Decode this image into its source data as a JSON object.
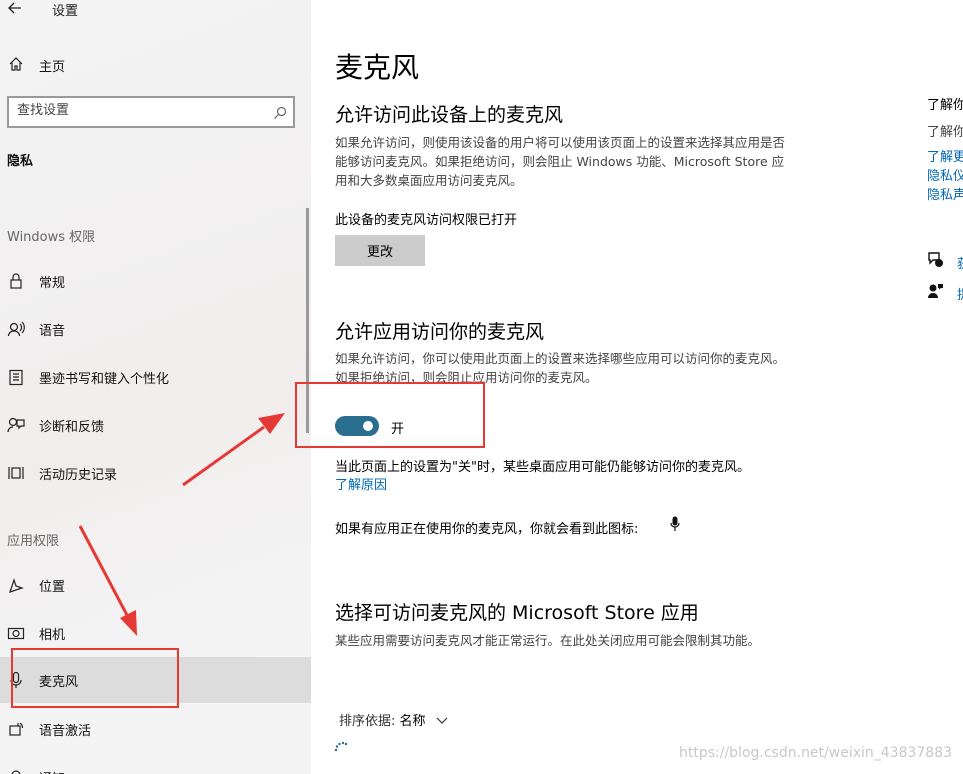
{
  "window": {
    "title": "设置"
  },
  "sidebar": {
    "home_label": "主页",
    "search": {
      "placeholder": "查找设置"
    },
    "section_title": "隐私",
    "windows_permissions": {
      "heading": "Windows 权限",
      "items": [
        {
          "label": "常规",
          "icon": "lock-icon"
        },
        {
          "label": "语音",
          "icon": "speech-icon"
        },
        {
          "label": "墨迹书写和键入个性化",
          "icon": "clipboard-icon"
        },
        {
          "label": "诊断和反馈",
          "icon": "feedback-icon"
        },
        {
          "label": "活动历史记录",
          "icon": "timeline-icon"
        }
      ]
    },
    "app_permissions": {
      "heading": "应用权限",
      "items": [
        {
          "label": "位置",
          "icon": "location-icon"
        },
        {
          "label": "相机",
          "icon": "camera-icon"
        },
        {
          "label": "麦克风",
          "icon": "microphone-icon",
          "selected": true
        },
        {
          "label": "语音激活",
          "icon": "voice-activation-icon"
        },
        {
          "label": "通知",
          "icon": "notification-icon"
        }
      ]
    }
  },
  "main": {
    "title": "麦克风",
    "device_section": {
      "heading": "允许访问此设备上的麦克风",
      "description": "如果允许访问，则使用该设备的用户将可以使用该页面上的设置来选择其应用是否能够访问麦克风。如果拒绝访问，则会阻止 Windows 功能、Microsoft Store 应用和大多数桌面应用访问麦克风。",
      "status": "此设备的麦克风访问权限已打开",
      "change_button": "更改"
    },
    "apps_section": {
      "heading": "允许应用访问你的麦克风",
      "description": "如果允许访问，你可以使用此页面上的设置来选择哪些应用可以访问你的麦克风。如果拒绝访问，则会阻止应用访问你的麦克风。",
      "toggle_state": "开",
      "toggle_on": true,
      "note": "当此页面上的设置为\"关\"时，某些桌面应用可能仍能够访问你的麦克风。",
      "learn_why_link": "了解原因",
      "icon_note": "如果有应用正在使用你的麦克风，你就会看到此图标:"
    },
    "store_section": {
      "heading": "选择可访问麦克风的 Microsoft Store 应用",
      "description": "某些应用需要访问麦克风才能正常运行。在此处关闭应用可能会限制其功能。",
      "sort_label": "排序依据:",
      "sort_value": "名称"
    }
  },
  "right_panel": {
    "heading": "了解你",
    "subtext": "了解你",
    "links": [
      "了解更",
      "隐私仪",
      "隐私声"
    ],
    "actions": [
      {
        "icon": "get-help-icon",
        "label": "获"
      },
      {
        "icon": "give-feedback-icon",
        "label": "提"
      }
    ]
  },
  "watermark": "https://blog.csdn.net/weixin_43837883",
  "colors": {
    "accent": "#2a6f8f",
    "link": "#0067b8",
    "annotation": "#e53935"
  }
}
